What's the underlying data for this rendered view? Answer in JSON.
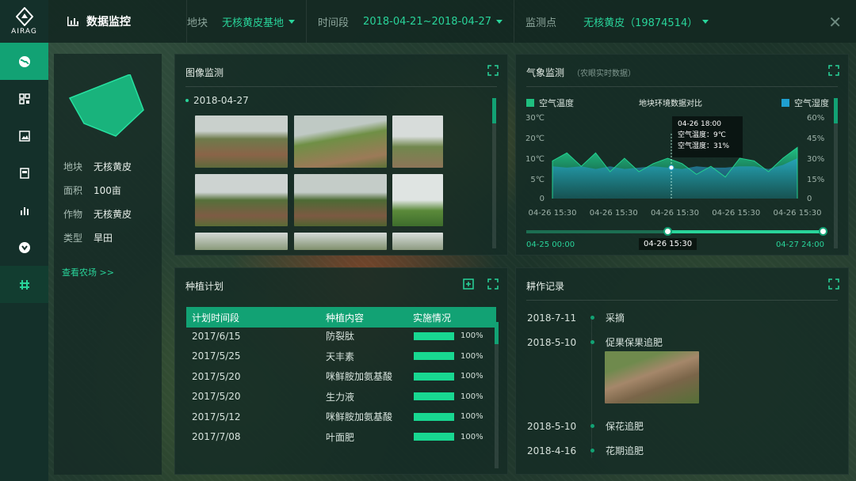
{
  "brand": "AIRAG",
  "header": {
    "title": "数据监控",
    "block_label": "地块",
    "block_value": "无核黄皮基地",
    "period_label": "时间段",
    "period_value": "2018-04-21~2018-04-27",
    "station_label": "监测点",
    "station_value": "无核黄皮（19874514）"
  },
  "farm": {
    "rows": [
      {
        "k": "地块",
        "v": "无核黄皮"
      },
      {
        "k": "面积",
        "v": "100亩"
      },
      {
        "k": "作物",
        "v": "无核黄皮"
      },
      {
        "k": "类型",
        "v": "旱田"
      }
    ],
    "link": "查看农场 >>"
  },
  "image_panel": {
    "title": "图像监测",
    "date": "2018-04-27"
  },
  "weather": {
    "title": "气象监测",
    "subtitle": "（农眼实时数据）",
    "legend_left": "空气温度",
    "legend_center": "地块环境数据对比",
    "legend_right": "空气湿度",
    "tooltip": {
      "time": "04-26 18:00",
      "temp": "空气温度：9℃",
      "hum": "空气湿度：31%"
    },
    "range_start": "04-25  00:00",
    "range_mid": "04-26  15:30",
    "range_end": "04-27  24:00"
  },
  "chart_data": {
    "type": "area",
    "x": [
      "04-26 15:30",
      "04-26 15:30",
      "04-26 15:30",
      "04-26 15:30",
      "04-26 15:30"
    ],
    "yleft_ticks": [
      "30℃",
      "20℃",
      "10℃",
      "5℃",
      "0"
    ],
    "yright_ticks": [
      "60%",
      "45%",
      "30%",
      "15%",
      "0"
    ],
    "series": [
      {
        "name": "空气温度",
        "values": [
          14,
          17,
          12,
          17,
          10,
          15,
          10,
          13,
          15,
          13,
          9,
          12,
          8,
          15,
          14,
          10,
          15,
          19
        ]
      },
      {
        "name": "空气湿度",
        "values": [
          24,
          23,
          24,
          22,
          24,
          22,
          23,
          24,
          23,
          22,
          24,
          23,
          23,
          24,
          24,
          22,
          25,
          30
        ]
      }
    ],
    "colors": {
      "temp": "#1fbf7f",
      "hum": "#1f9fd0"
    },
    "ylim_left": [
      0,
      30
    ],
    "ylim_right": [
      0,
      60
    ]
  },
  "plan": {
    "title": "种植计划",
    "cols": [
      "计划时间段",
      "种植内容",
      "实施情况"
    ],
    "rows": [
      {
        "d": "2017/6/15",
        "c": "防裂肽",
        "p": "100%"
      },
      {
        "d": "2017/5/25",
        "c": "天丰素",
        "p": "100%"
      },
      {
        "d": "2017/5/20",
        "c": "咪鲜胺加氨基酸",
        "p": "100%"
      },
      {
        "d": "2017/5/20",
        "c": "生力液",
        "p": "100%"
      },
      {
        "d": "2017/5/12",
        "c": "咪鲜胺加氨基酸",
        "p": "100%"
      },
      {
        "d": "2017/7/08",
        "c": "叶面肥",
        "p": "100%"
      }
    ]
  },
  "records": {
    "title": "耕作记录",
    "items": [
      {
        "d": "2018-7-11",
        "t": "采摘"
      },
      {
        "d": "2018-5-10",
        "t": "促果保果追肥"
      },
      {
        "d": "2018-5-10",
        "t": "保花追肥"
      },
      {
        "d": "2018-4-16",
        "t": "花期追肥"
      }
    ]
  }
}
